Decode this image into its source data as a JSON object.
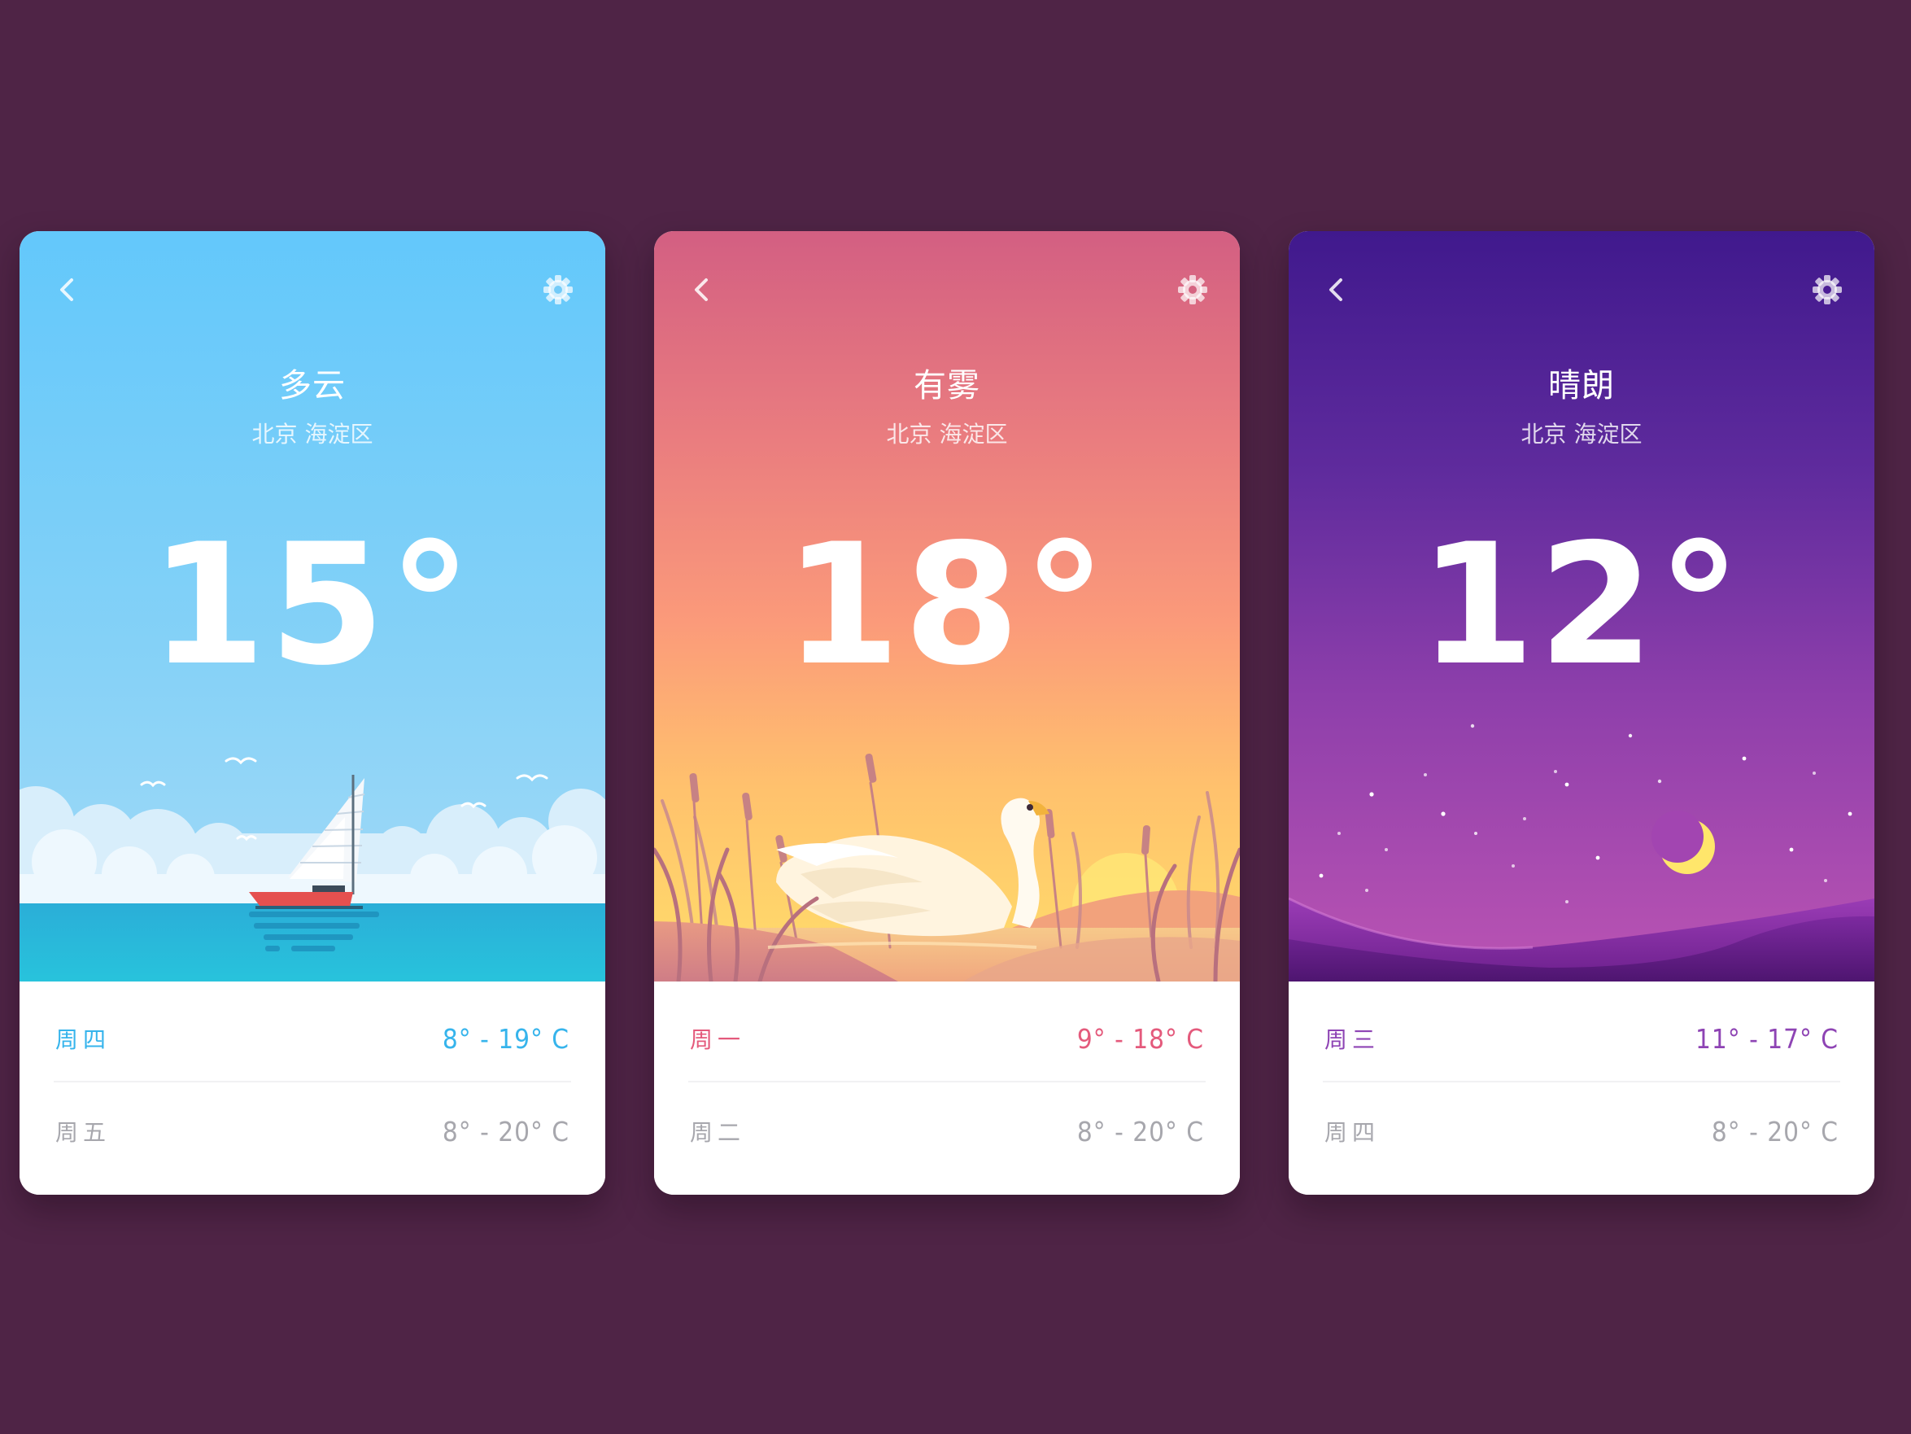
{
  "cards": [
    {
      "condition": "多云",
      "location": "北京 海淀区",
      "temperature": "15°",
      "accent_color": "#36b4ec",
      "back_icon": "chevron-left-icon",
      "settings_icon": "gear-icon",
      "forecast": [
        {
          "day": "周四",
          "range": "8° - 19° C",
          "highlighted": true
        },
        {
          "day": "周五",
          "range": "8° - 20° C",
          "highlighted": false
        }
      ]
    },
    {
      "condition": "有雾",
      "location": "北京 海淀区",
      "temperature": "18°",
      "accent_color": "#e45a7c",
      "back_icon": "chevron-left-icon",
      "settings_icon": "gear-icon",
      "forecast": [
        {
          "day": "周一",
          "range": "9° - 18° C",
          "highlighted": true
        },
        {
          "day": "周二",
          "range": "8° - 20° C",
          "highlighted": false
        }
      ]
    },
    {
      "condition": "晴朗",
      "location": "北京 海淀区",
      "temperature": "12°",
      "accent_color": "#8e44b4",
      "back_icon": "chevron-left-icon",
      "settings_icon": "gear-icon",
      "forecast": [
        {
          "day": "周三",
          "range": "11° - 17° C",
          "highlighted": true
        },
        {
          "day": "周四",
          "range": "8° - 20° C",
          "highlighted": false
        }
      ]
    }
  ]
}
